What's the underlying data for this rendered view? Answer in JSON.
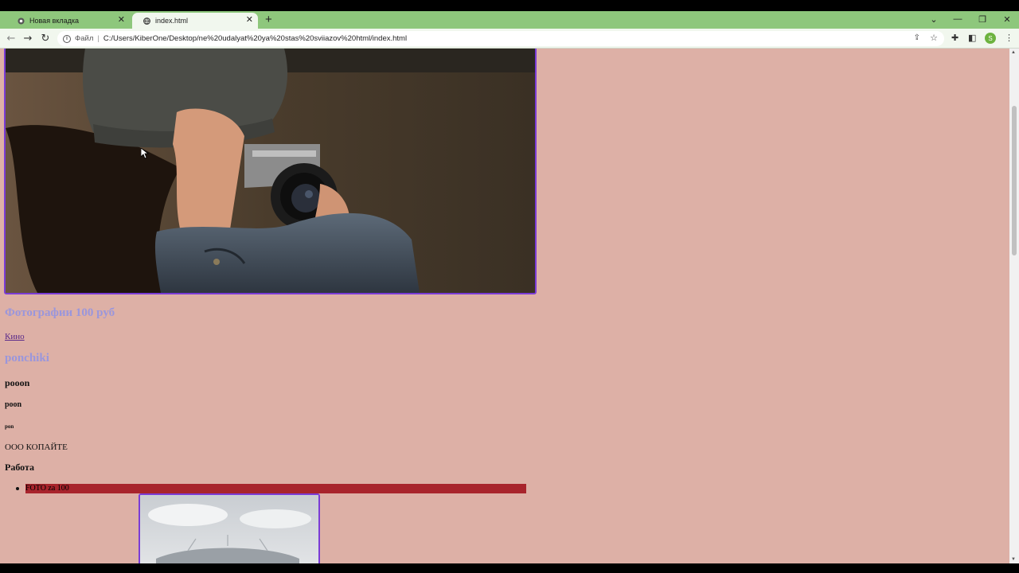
{
  "browser": {
    "tabs": [
      {
        "label": "Новая вкладка",
        "icon": "chrome-icon",
        "active": false
      },
      {
        "label": "index.html",
        "icon": "globe-icon",
        "active": true
      }
    ],
    "new_tab_symbol": "+",
    "scheme_label": "Файл",
    "url": "C:/Users/KiberOne/Desktop/ne%20udalyat%20ya%20stas%20sviiazov%20html/index.html",
    "profile_initial": "S",
    "colors": {
      "tabstrip": "#8ec77c",
      "toolbar": "#f1f7ee"
    }
  },
  "page": {
    "background": "#ddb0a6",
    "hero_image": "photographer-with-camera",
    "heading_price": "Фотографии 100 руб",
    "link_kino": "Кино",
    "heading_ponchiki": "ponchiki",
    "h3_text": "pooon",
    "h4_text": "poon",
    "h6_text": "pon",
    "paragraph": "ООО КОПАЙТЕ",
    "section_heading": "Работа",
    "list_items": [
      "FOTO za 100"
    ],
    "second_image": "stadium-cloudy-sky",
    "colors": {
      "link_heading": "#9a96dc",
      "image_border": "#7a3cd6",
      "list_bg": "#a8242c"
    }
  }
}
